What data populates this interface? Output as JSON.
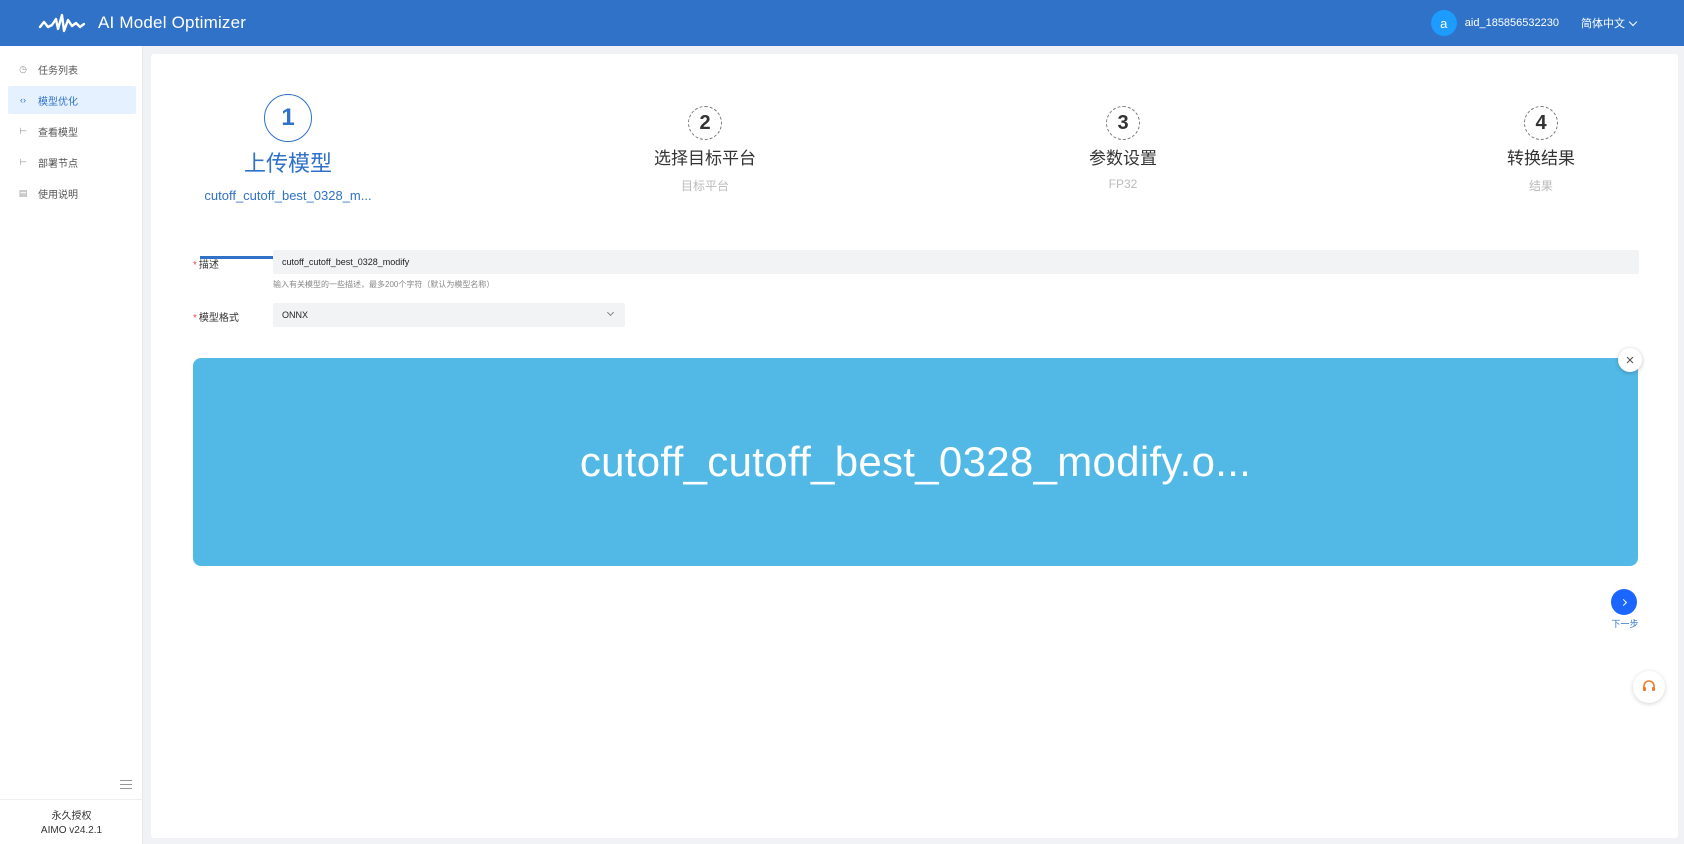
{
  "header": {
    "app_title": "AI Model Optimizer",
    "avatar_letter": "a",
    "username": "aid_185856532230",
    "language": "简体中文"
  },
  "sidebar": {
    "items": [
      {
        "label": "任务列表",
        "icon": "clock-icon"
      },
      {
        "label": "模型优化",
        "icon": "code-icon",
        "active": true
      },
      {
        "label": "查看模型",
        "icon": "model-icon"
      },
      {
        "label": "部署节点",
        "icon": "deploy-icon"
      },
      {
        "label": "使用说明",
        "icon": "doc-icon"
      }
    ],
    "license_line1": "永久授权",
    "license_line2": "AIMO v24.2.1"
  },
  "steps": [
    {
      "number": "1",
      "title": "上传模型",
      "subtitle": "cutoff_cutoff_best_0328_m..."
    },
    {
      "number": "2",
      "title": "选择目标平台",
      "subtitle": "目标平台"
    },
    {
      "number": "3",
      "title": "参数设置",
      "subtitle": "FP32"
    },
    {
      "number": "4",
      "title": "转换结果",
      "subtitle": "结果"
    }
  ],
  "form": {
    "required_mark": "*",
    "description_label": "描述",
    "description_value": "cutoff_cutoff_best_0328_modify",
    "description_hint": "输入有关模型的一些描述，最多200个字符（默认为模型名称）",
    "format_label": "模型格式",
    "format_value": "ONNX"
  },
  "upload": {
    "file_name": "cutoff_cutoff_best_0328_modify.o...",
    "close_symbol": "×"
  },
  "next_label": "下一步",
  "colors": {
    "header_bg": "#2f72c8",
    "accent": "#2f72c8",
    "banner_bg": "#52b9e7",
    "next_button": "#1a66ff"
  }
}
